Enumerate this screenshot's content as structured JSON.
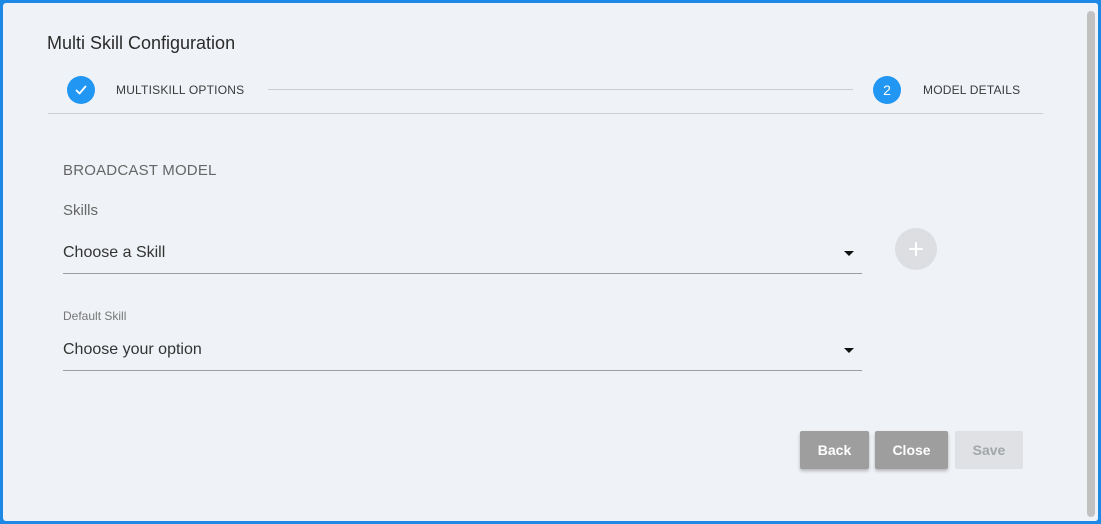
{
  "dialog": {
    "title": "Multi Skill Configuration"
  },
  "stepper": {
    "steps": [
      {
        "label": "MULTISKILL OPTIONS",
        "state": "complete",
        "icon": "check-icon"
      },
      {
        "label": "MODEL DETAILS",
        "state": "active",
        "number": "2"
      }
    ]
  },
  "form": {
    "section_title": "BROADCAST MODEL",
    "skills": {
      "label": "Skills",
      "value": "Choose a Skill"
    },
    "default_skill": {
      "label": "Default Skill",
      "value": "Choose your option"
    },
    "add_icon": "plus-icon"
  },
  "actions": {
    "back": "Back",
    "close": "Close",
    "save": "Save"
  },
  "colors": {
    "accent": "#2196f3",
    "frame": "#1e88e5",
    "button": "#9e9e9e",
    "button_disabled": "#dfe1e4"
  }
}
